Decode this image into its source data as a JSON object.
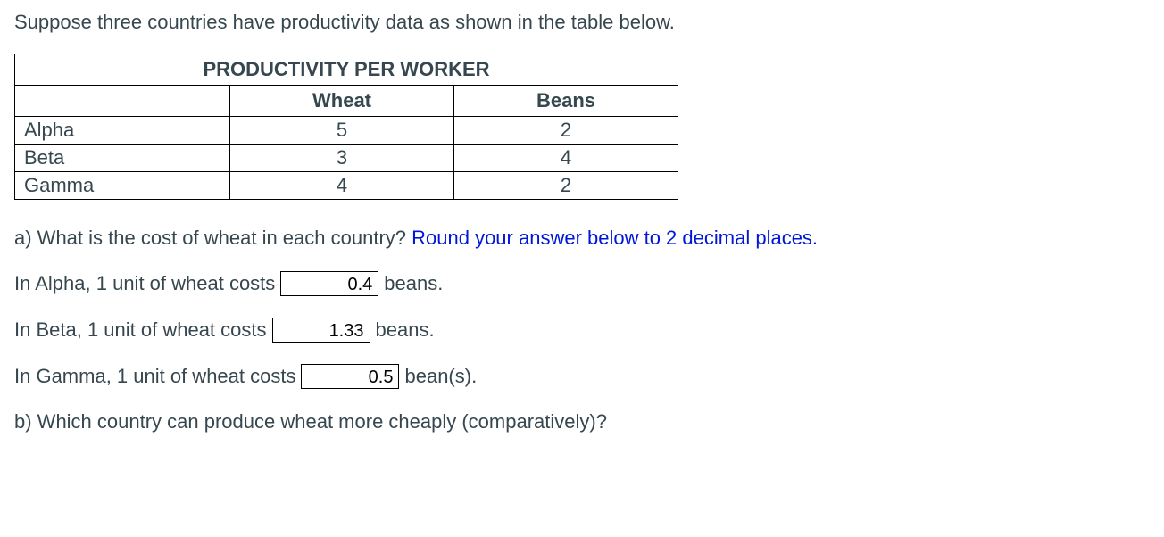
{
  "intro": "Suppose three countries have productivity data as shown in the table below.",
  "table": {
    "title": "PRODUCTIVITY PER WORKER",
    "col1": "Wheat",
    "col2": "Beans",
    "rows": [
      {
        "label": "Alpha",
        "wheat": "5",
        "beans": "2"
      },
      {
        "label": "Beta",
        "wheat": "3",
        "beans": "4"
      },
      {
        "label": "Gamma",
        "wheat": "4",
        "beans": "2"
      }
    ]
  },
  "qa": {
    "partA": "a) What is the cost of wheat in each country? ",
    "partA_blue": "Round your answer below to 2 decimal places.",
    "lineAlpha_pre": "In Alpha, 1 unit of wheat costs",
    "lineAlpha_val": "0.4",
    "lineAlpha_post": "beans.",
    "lineBeta_pre": "In Beta, 1 unit of wheat costs",
    "lineBeta_val": "1.33",
    "lineBeta_post": "beans.",
    "lineGamma_pre": "In Gamma, 1 unit of wheat costs",
    "lineGamma_val": "0.5",
    "lineGamma_post": "bean(s).",
    "partB": "b) Which country can produce wheat more cheaply (comparatively)?"
  }
}
